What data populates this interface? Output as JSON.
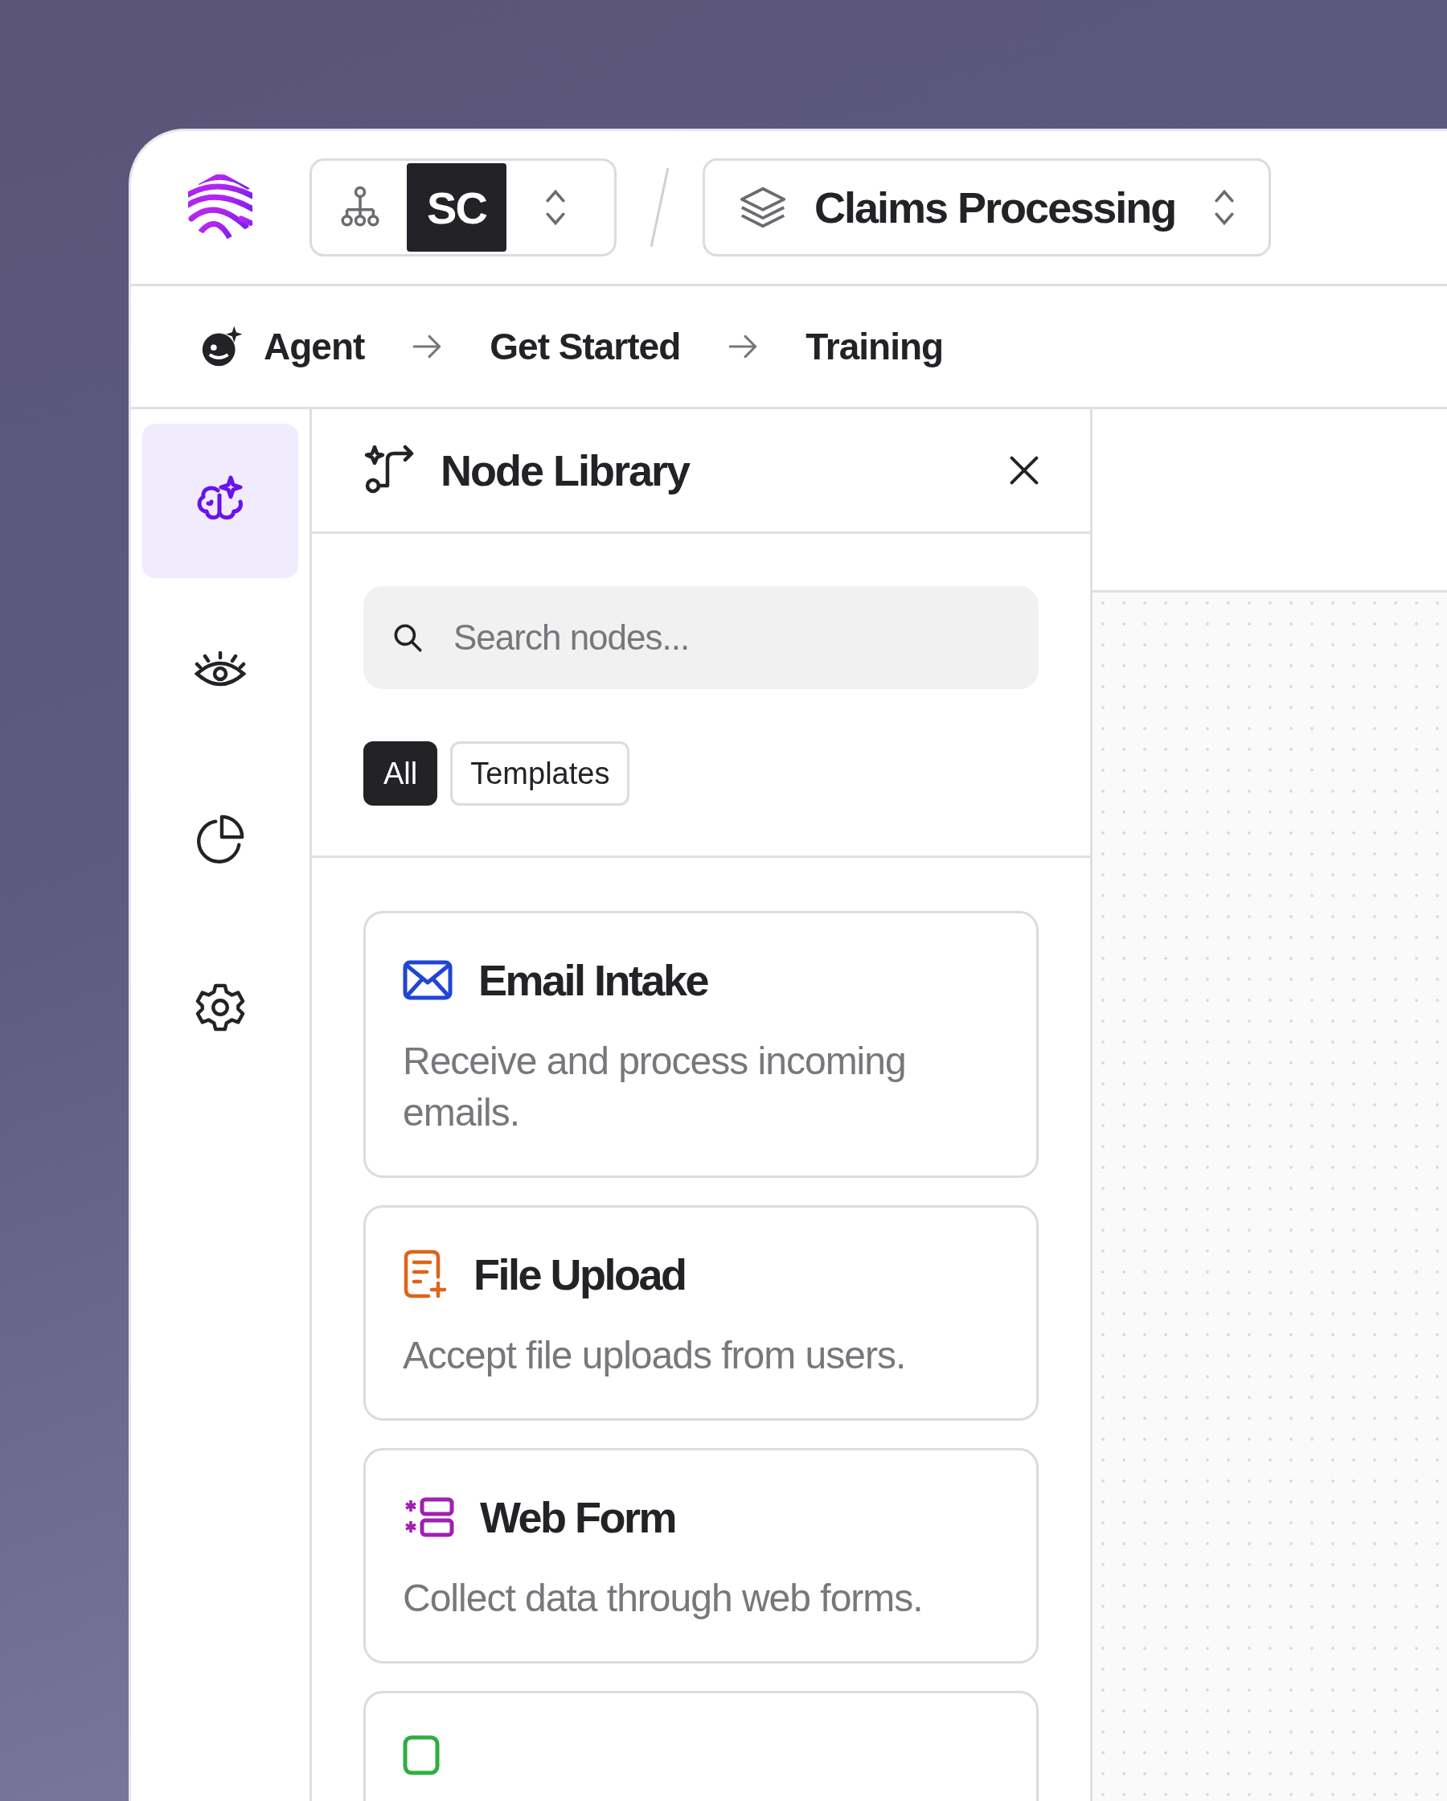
{
  "org_switcher": {
    "initials": "SC"
  },
  "project_switcher": {
    "name": "Claims Processing"
  },
  "breadcrumbs": [
    {
      "label": "Agent"
    },
    {
      "label": "Get Started"
    },
    {
      "label": "Training"
    }
  ],
  "rail": [
    {
      "kind": "brain",
      "selected": true
    },
    {
      "kind": "eye",
      "selected": false
    },
    {
      "kind": "chart",
      "selected": false
    },
    {
      "kind": "settings",
      "selected": false
    }
  ],
  "panel": {
    "title": "Node Library",
    "search": {
      "placeholder": "Search nodes..."
    },
    "filters": [
      {
        "label": "All",
        "selected": true
      },
      {
        "label": "Templates",
        "selected": false
      }
    ],
    "nodes": [
      {
        "kind": "email",
        "color": "#2145d4",
        "title": "Email Intake",
        "description": "Receive and process incoming emails."
      },
      {
        "kind": "file",
        "color": "#e0631a",
        "title": "File Upload",
        "description": "Accept file uploads from users."
      },
      {
        "kind": "form",
        "color": "#a020b0",
        "title": "Web Form",
        "description": "Collect data through web forms."
      },
      {
        "kind": "partial",
        "color": "#2fae3f"
      }
    ]
  }
}
